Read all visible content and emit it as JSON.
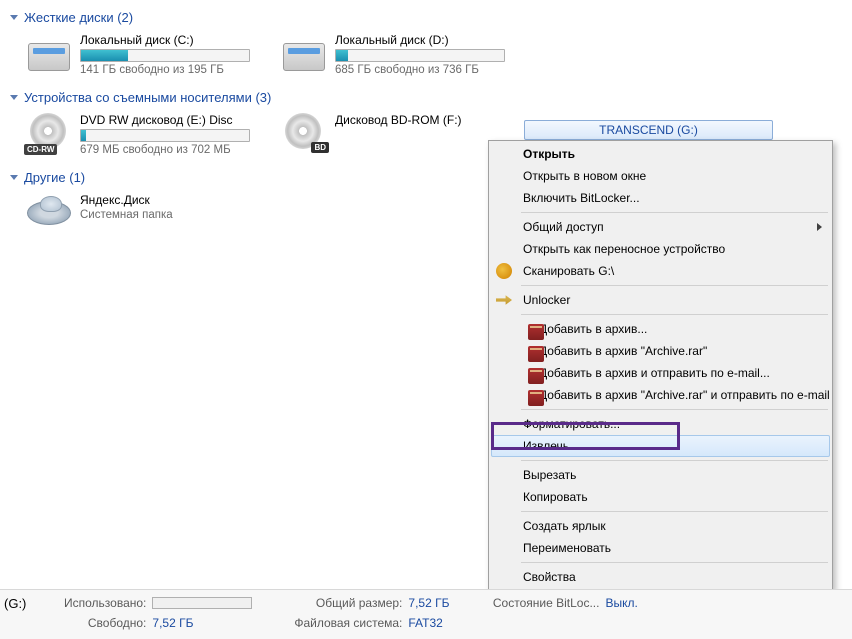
{
  "groups": {
    "hard_drives": {
      "title": "Жесткие диски (2)"
    },
    "removable": {
      "title": "Устройства со съемными носителями (3)"
    },
    "other": {
      "title": "Другие (1)"
    }
  },
  "drives": {
    "c": {
      "name": "Локальный диск (C:)",
      "status": "141 ГБ свободно из 195 ГБ",
      "fill_pct": 28
    },
    "d": {
      "name": "Локальный диск (D:)",
      "status": "685 ГБ свободно из 736 ГБ",
      "fill_pct": 7
    },
    "e": {
      "name": "DVD RW дисковод (E:) Disc",
      "status": "679 МБ свободно из 702 МБ",
      "fill_pct": 3,
      "badge": "CD-RW"
    },
    "f": {
      "name": "Дисковод BD-ROM (F:)",
      "badge": "BD"
    },
    "g": {
      "name": "TRANSCEND (G:)"
    },
    "yandex": {
      "name": "Яндекс.Диск",
      "status": "Системная папка"
    }
  },
  "context_menu": {
    "open": "Открыть",
    "open_new": "Открыть в новом окне",
    "bitlocker": "Включить BitLocker...",
    "share": "Общий доступ",
    "portable": "Открыть как переносное устройство",
    "scan": "Сканировать G:\\",
    "unlocker": "Unlocker",
    "add_archive": "Добавить в архив...",
    "add_archive_rar": "Добавить в архив \"Archive.rar\"",
    "add_email": "Добавить в архив и отправить по e-mail...",
    "add_rar_email": "Добавить в архив \"Archive.rar\" и отправить по e-mail",
    "format": "Форматировать...",
    "eject": "Извлечь",
    "cut": "Вырезать",
    "copy": "Копировать",
    "shortcut": "Создать ярлык",
    "rename": "Переименовать",
    "properties": "Свойства"
  },
  "status_bar": {
    "drive_letter": "(G:)",
    "used_label": "Использовано:",
    "free_label": "Свободно:",
    "free_value": "7,52 ГБ",
    "total_label": "Общий размер:",
    "total_value": "7,52 ГБ",
    "fs_label": "Файловая система:",
    "fs_value": "FAT32",
    "bitlocker_label": "Состояние BitLoc...",
    "bitlocker_value": "Выкл."
  }
}
